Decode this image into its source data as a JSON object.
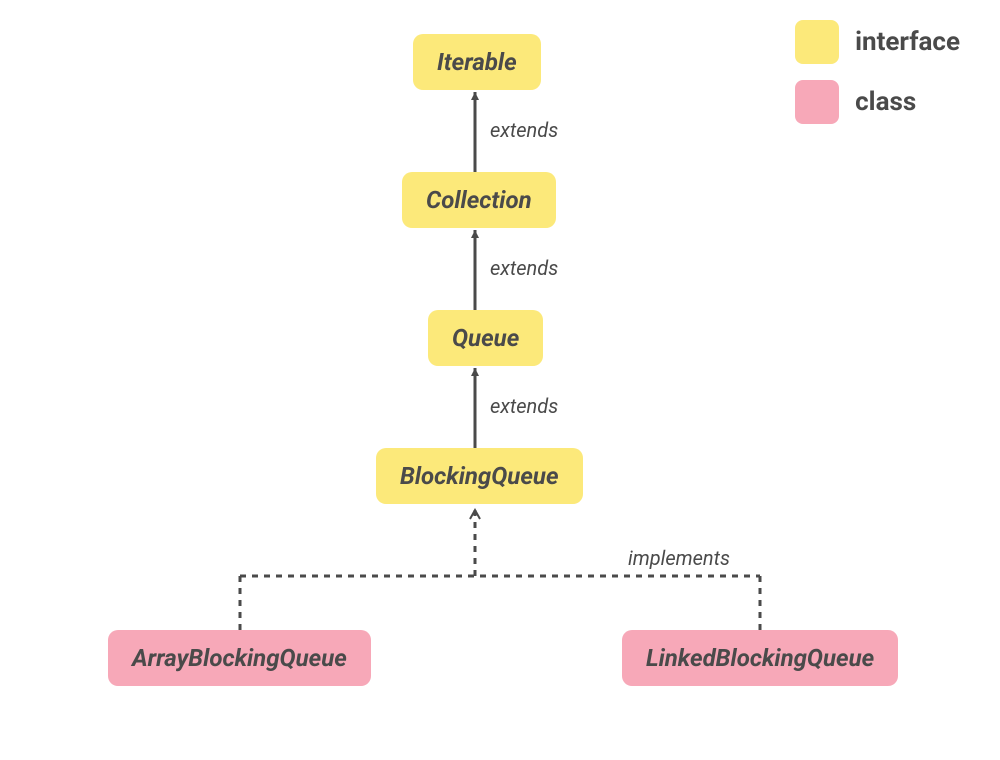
{
  "colors": {
    "interface": "#fce97a",
    "class": "#f7a8b8",
    "text": "#4a4a4a",
    "line": "#4a4a4a"
  },
  "legend": {
    "interface": "interface",
    "class": "class"
  },
  "nodes": {
    "iterable": {
      "label": "Iterable",
      "kind": "interface"
    },
    "collection": {
      "label": "Collection",
      "kind": "interface"
    },
    "queue": {
      "label": "Queue",
      "kind": "interface"
    },
    "blockingqueue": {
      "label": "BlockingQueue",
      "kind": "interface"
    },
    "arrayblocking": {
      "label": "ArrayBlockingQueue",
      "kind": "class"
    },
    "linkedblocking": {
      "label": "LinkedBlockingQueue",
      "kind": "class"
    }
  },
  "edges": {
    "extends1": {
      "label": "extends",
      "from": "collection",
      "to": "iterable",
      "style": "solid"
    },
    "extends2": {
      "label": "extends",
      "from": "queue",
      "to": "collection",
      "style": "solid"
    },
    "extends3": {
      "label": "extends",
      "from": "blockingqueue",
      "to": "queue",
      "style": "solid"
    },
    "implements": {
      "label": "implements",
      "from": [
        "arrayblocking",
        "linkedblocking"
      ],
      "to": "blockingqueue",
      "style": "dashed"
    }
  }
}
